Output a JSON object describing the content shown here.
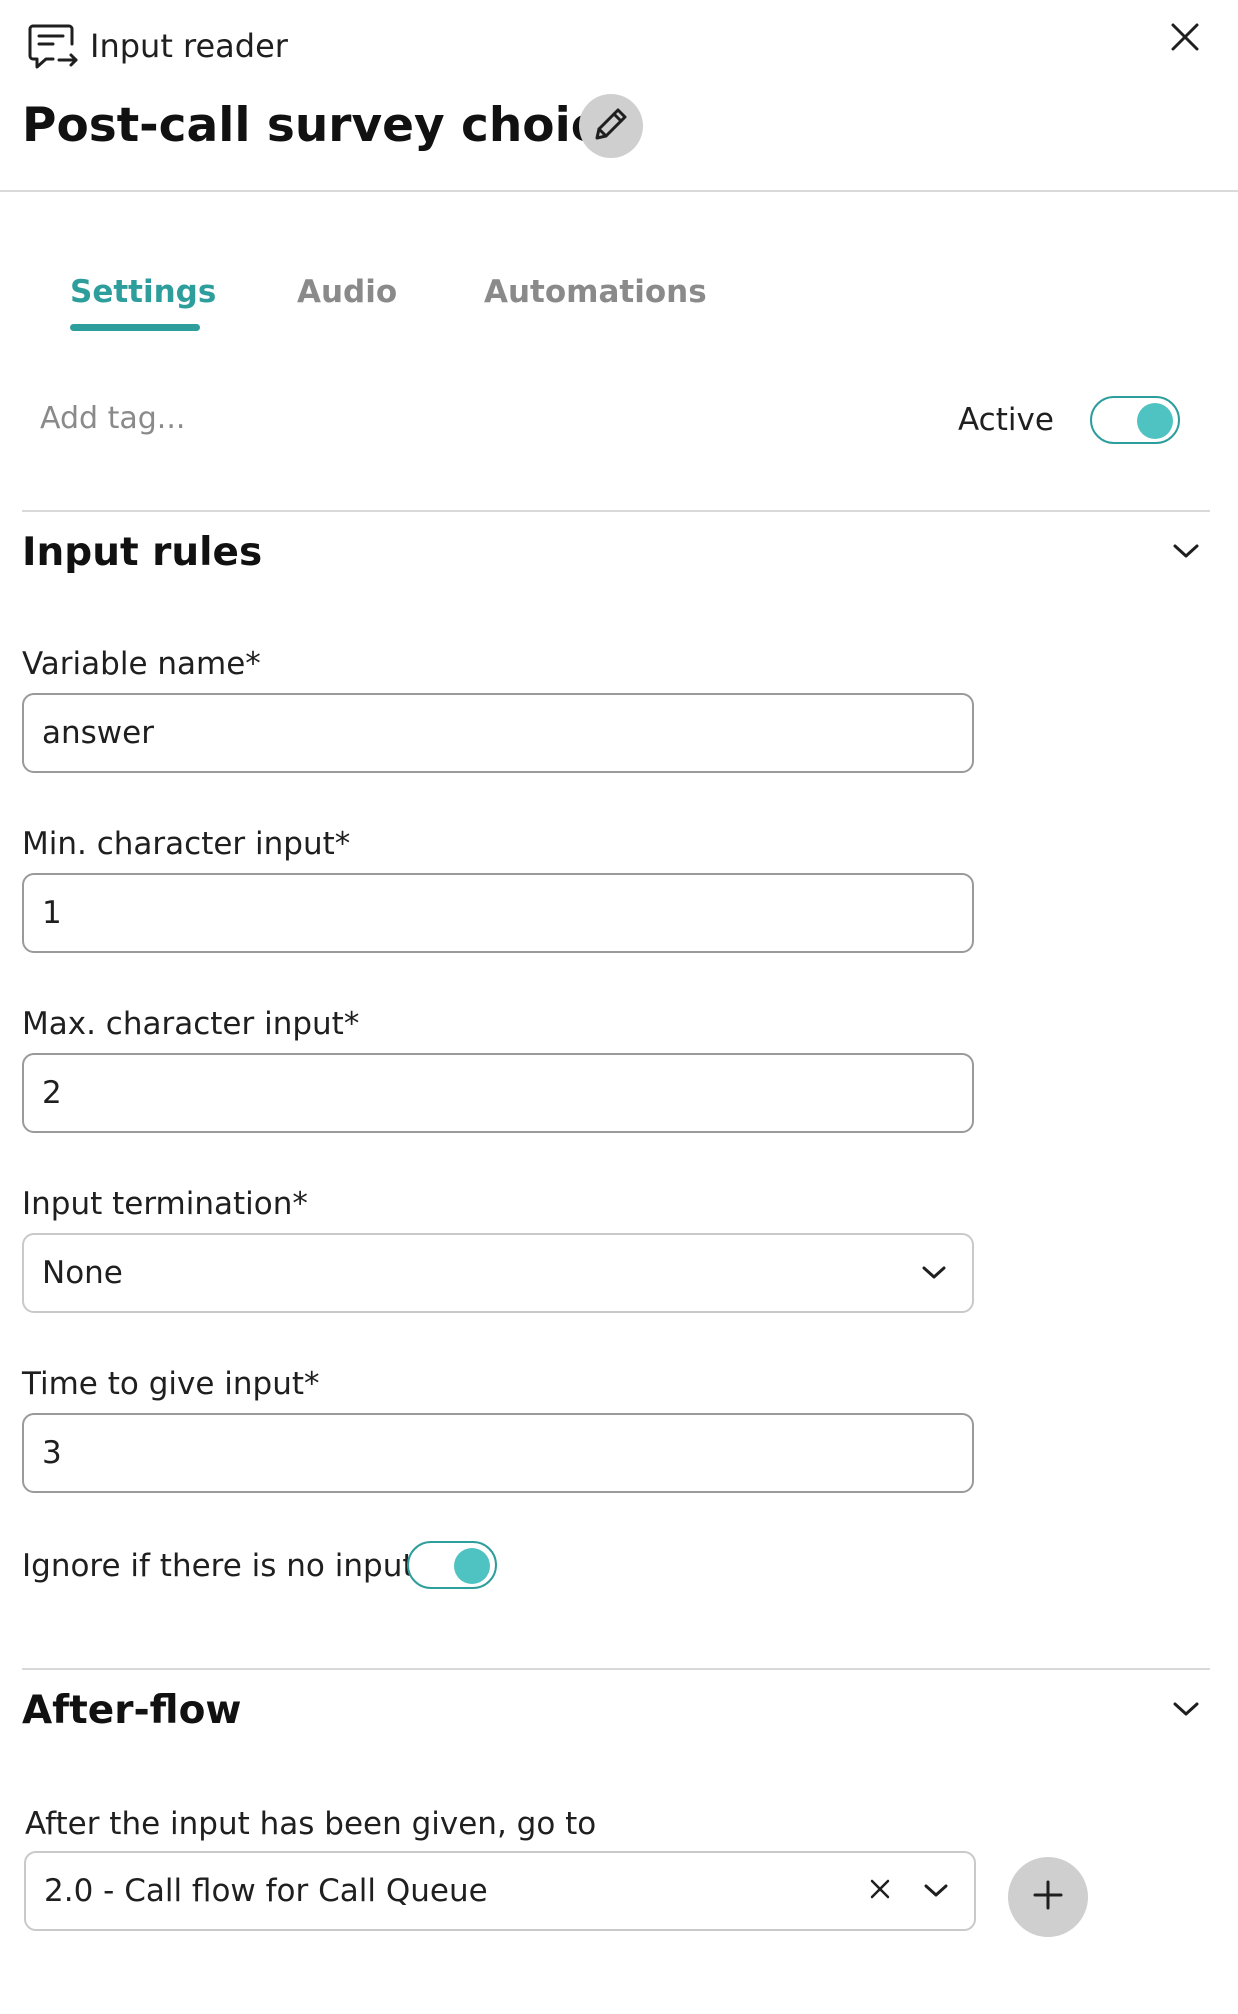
{
  "header": {
    "panel_type": "Input reader",
    "title": "Post-call survey choice",
    "icons": {
      "panel": "input-reader-icon",
      "close": "close-icon",
      "edit": "pencil-icon"
    }
  },
  "tabs": [
    {
      "label": "Settings",
      "active": true
    },
    {
      "label": "Audio",
      "active": false
    },
    {
      "label": "Automations",
      "active": false
    }
  ],
  "tags": {
    "placeholder": "Add tag..."
  },
  "status": {
    "label": "Active",
    "enabled": true
  },
  "input_rules": {
    "title": "Input rules",
    "variable_name": {
      "label": "Variable name*",
      "value": "answer"
    },
    "min_chars": {
      "label": "Min. character input*",
      "value": "1"
    },
    "max_chars": {
      "label": "Max. character input*",
      "value": "2"
    },
    "termination": {
      "label": "Input termination*",
      "value": "None"
    },
    "time_to_give": {
      "label": "Time to give input*",
      "value": "3"
    },
    "ignore_no_input": {
      "label": "Ignore if there is no input",
      "enabled": true
    }
  },
  "after_flow": {
    "title": "After-flow",
    "goto_label": "After the input has been given, go to",
    "goto_value": "2.0 - Call flow for Call Queue"
  },
  "colors": {
    "accent": "#2e9e9c",
    "toggle_knob": "#4fc3c1",
    "muted_text": "#8a8a8a",
    "button_bg": "#cfcfcf",
    "divider": "#d9d9d9"
  }
}
